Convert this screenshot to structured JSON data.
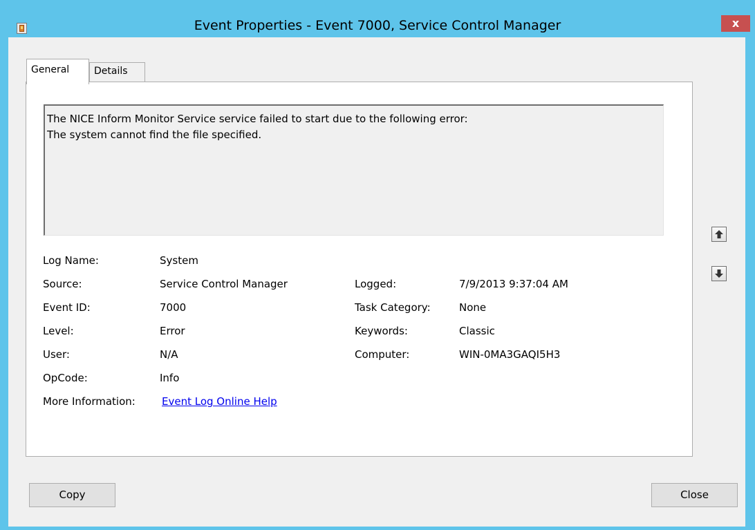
{
  "window": {
    "title": "Event Properties - Event 7000, Service Control Manager",
    "close_label": "x"
  },
  "tabs": [
    {
      "label": "General",
      "selected": true
    },
    {
      "label": "Details",
      "selected": false
    }
  ],
  "message": {
    "line1": "The NICE Inform Monitor Service service failed to start due to the following error:",
    "line2": "The system cannot find the file specified."
  },
  "properties": {
    "log_name": {
      "label": "Log Name:",
      "value": "System"
    },
    "source": {
      "label": "Source:",
      "value": "Service Control Manager"
    },
    "event_id": {
      "label": "Event ID:",
      "value": "7000"
    },
    "level": {
      "label": "Level:",
      "value": "Error"
    },
    "user": {
      "label": "User:",
      "value": "N/A"
    },
    "opcode": {
      "label": "OpCode:",
      "value": "Info"
    },
    "more_info": {
      "label": "More Information:",
      "link": "Event Log Online Help"
    },
    "logged": {
      "label": "Logged:",
      "value": "7/9/2013 9:37:04 AM"
    },
    "task_category": {
      "label": "Task Category:",
      "value": "None"
    },
    "keywords": {
      "label": "Keywords:",
      "value": "Classic"
    },
    "computer": {
      "label": "Computer:",
      "value": "WIN-0MA3GAQI5H3"
    }
  },
  "buttons": {
    "copy": "Copy",
    "close": "Close"
  },
  "colors": {
    "title_bar": "#5ec4ea",
    "close_button": "#c75050",
    "link": "#0000ee"
  },
  "icons": [
    "event-viewer-icon",
    "up-arrow-icon",
    "down-arrow-icon"
  ]
}
